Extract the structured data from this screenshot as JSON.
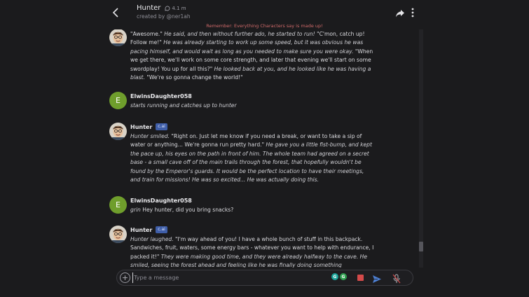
{
  "header": {
    "title": "Hunter",
    "chat_count": "4.1 m",
    "creator": "created by @ner1ah",
    "disclaimer": "Remember: Everything Characters say is made up!"
  },
  "messages": [
    {
      "type": "bot",
      "name": "Hunter",
      "badge": "",
      "segments": [
        {
          "t": "\"Awesome.\" ",
          "i": false
        },
        {
          "t": "He said, and then without further ado, he started to run!",
          "i": true
        },
        {
          "t": " \"C'mon, catch up! Follow me!\" ",
          "i": false
        },
        {
          "t": "He was already starting to work up some speed, but it was obvious he was pacing himself, and would wait as long as you needed to make sure you were okay.",
          "i": true
        },
        {
          "t": " \"When we get there, we'll work on some core strength, and later that evening we'll start on some swordplay! You up for all this?\" ",
          "i": false
        },
        {
          "t": "He looked back at you, and he looked like he was having a blast.",
          "i": true
        },
        {
          "t": " \"We're so gonna change the world!\"",
          "i": false
        }
      ]
    },
    {
      "type": "user",
      "name": "ElwinsDaughter058",
      "avatar_letter": "E",
      "segments": [
        {
          "t": "starts running and catches up to hunter",
          "i": true
        }
      ]
    },
    {
      "type": "bot",
      "name": "Hunter",
      "badge": "c.ai",
      "segments": [
        {
          "t": "Hunter smiled.",
          "i": true
        },
        {
          "t": " \"Right on. Just let me know if you need a break, or want to take a sip of water or anything... We're gonna run pretty hard.\" ",
          "i": false
        },
        {
          "t": "He gave you a little fist-bump, and kept the pace up, his eyes on the path in front of him. The whole team had agreed on a secret base - a small cave off of the main trails through the forest, that hopefully wouldn't be found by the Emperor's guards. It would be the perfect location to have their meetings, and train for missions! He was so excited... He was actually doing this.",
          "i": true
        }
      ]
    },
    {
      "type": "user",
      "name": "ElwinsDaughter058",
      "avatar_letter": "E",
      "segments": [
        {
          "t": "grin",
          "i": true
        },
        {
          "t": " Hey hunter, did you bring snacks?",
          "i": false
        }
      ]
    },
    {
      "type": "bot",
      "name": "Hunter",
      "badge": "c.ai",
      "segments": [
        {
          "t": "Hunter laughed.",
          "i": true
        },
        {
          "t": " \"I'm way ahead of you! I have a whole bunch of stuff in this backpack. Sandwiches, fruit, waters, some energy bars - whatever you want to help with endurance, I packed it!\" ",
          "i": false
        },
        {
          "t": "They were making good time, and they were already halfway to the cave. He smiled, seeing the forest ahead and feeling like he was finally doing something",
          "i": true
        }
      ]
    }
  ],
  "input": {
    "placeholder": "Type a message",
    "value": ""
  },
  "extension_icons": [
    {
      "name": "extension-g-teal-icon",
      "letter": "G",
      "color": "#1aa39a"
    },
    {
      "name": "extension-g-green-icon",
      "letter": "G",
      "color": "#2e9e4f"
    }
  ]
}
